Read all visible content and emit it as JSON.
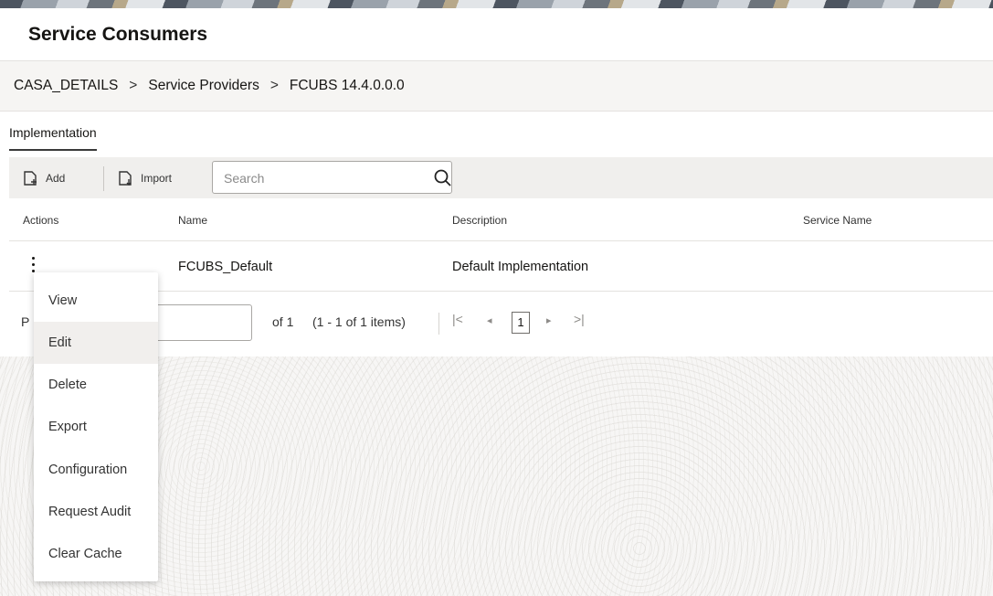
{
  "header": {
    "title": "Service Consumers"
  },
  "breadcrumb": {
    "items": [
      "CASA_DETAILS",
      "Service Providers",
      "FCUBS 14.4.0.0.0"
    ],
    "separator": ">"
  },
  "tabs": [
    {
      "label": "Implementation",
      "active": true
    }
  ],
  "toolbar": {
    "add_label": "Add",
    "import_label": "Import",
    "search_placeholder": "Search",
    "icons": {
      "add": "document-add-icon",
      "import": "document-import-icon",
      "search": "search-icon"
    }
  },
  "table": {
    "columns": [
      "Actions",
      "Name",
      "Description",
      "Service Name"
    ],
    "rows": [
      {
        "name": "FCUBS_Default",
        "description": "Default Implementation",
        "service_name": ""
      }
    ]
  },
  "pagination": {
    "page_label": "P",
    "of_pages": "of 1",
    "item_range": "(1 - 1 of 1 items)",
    "first_icon": "|<",
    "prev_icon": "◂",
    "current_page": "1",
    "next_icon": "▸",
    "last_icon": ">|"
  },
  "actions_menu": {
    "items": [
      "View",
      "Edit",
      "Delete",
      "Export",
      "Configuration",
      "Request Audit",
      "Clear Cache"
    ],
    "highlighted": "Edit"
  },
  "colors": {
    "toolbar_bg": "#f0efed",
    "breadcrumb_bg": "#f6f5f3",
    "menu_hover_bg": "#f1efed"
  }
}
